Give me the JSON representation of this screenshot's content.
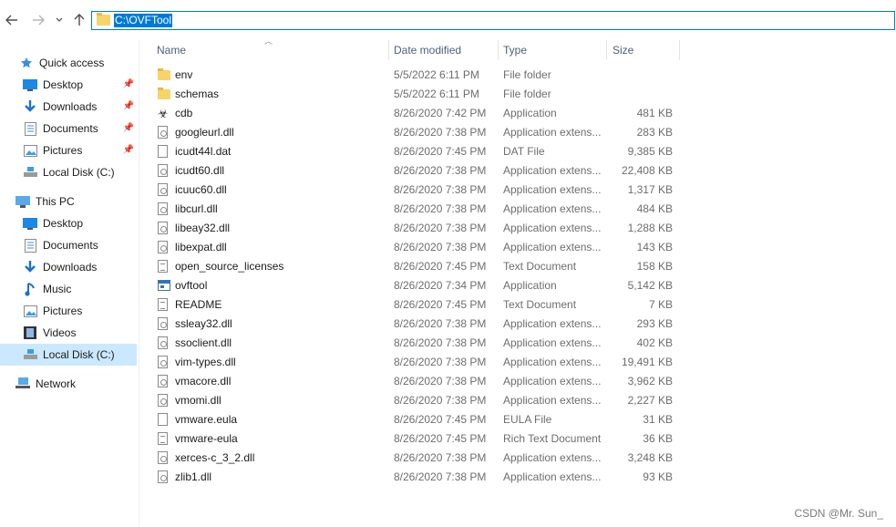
{
  "address": {
    "path": "C:\\OVFTool"
  },
  "sidebar": {
    "quick_access": "Quick access",
    "quick_items": [
      "Desktop",
      "Downloads",
      "Documents",
      "Pictures",
      "Local Disk (C:)"
    ],
    "this_pc": "This PC",
    "pc_items": [
      "Desktop",
      "Documents",
      "Downloads",
      "Music",
      "Pictures",
      "Videos",
      "Local Disk (C:)"
    ],
    "network": "Network"
  },
  "columns": {
    "name": "Name",
    "date": "Date modified",
    "type": "Type",
    "size": "Size"
  },
  "files": [
    {
      "name": "env",
      "date": "5/5/2022 6:11 PM",
      "type": "File folder",
      "size": "",
      "icon": "folder"
    },
    {
      "name": "schemas",
      "date": "5/5/2022 6:11 PM",
      "type": "File folder",
      "size": "",
      "icon": "folder"
    },
    {
      "name": "cdb",
      "date": "8/26/2020 7:42 PM",
      "type": "Application",
      "size": "481 KB",
      "icon": "cdb"
    },
    {
      "name": "googleurl.dll",
      "date": "8/26/2020 7:38 PM",
      "type": "Application extens...",
      "size": "283 KB",
      "icon": "dll"
    },
    {
      "name": "icudt44l.dat",
      "date": "8/26/2020 7:45 PM",
      "type": "DAT File",
      "size": "9,385 KB",
      "icon": "doc"
    },
    {
      "name": "icudt60.dll",
      "date": "8/26/2020 7:38 PM",
      "type": "Application extens...",
      "size": "22,408 KB",
      "icon": "dll"
    },
    {
      "name": "icuuc60.dll",
      "date": "8/26/2020 7:38 PM",
      "type": "Application extens...",
      "size": "1,317 KB",
      "icon": "dll"
    },
    {
      "name": "libcurl.dll",
      "date": "8/26/2020 7:38 PM",
      "type": "Application extens...",
      "size": "484 KB",
      "icon": "dll"
    },
    {
      "name": "libeay32.dll",
      "date": "8/26/2020 7:38 PM",
      "type": "Application extens...",
      "size": "1,288 KB",
      "icon": "dll"
    },
    {
      "name": "libexpat.dll",
      "date": "8/26/2020 7:38 PM",
      "type": "Application extens...",
      "size": "143 KB",
      "icon": "dll"
    },
    {
      "name": "open_source_licenses",
      "date": "8/26/2020 7:45 PM",
      "type": "Text Document",
      "size": "158 KB",
      "icon": "txt"
    },
    {
      "name": "ovftool",
      "date": "8/26/2020 7:34 PM",
      "type": "Application",
      "size": "5,142 KB",
      "icon": "app"
    },
    {
      "name": "README",
      "date": "8/26/2020 7:45 PM",
      "type": "Text Document",
      "size": "7 KB",
      "icon": "txt"
    },
    {
      "name": "ssleay32.dll",
      "date": "8/26/2020 7:38 PM",
      "type": "Application extens...",
      "size": "293 KB",
      "icon": "dll"
    },
    {
      "name": "ssoclient.dll",
      "date": "8/26/2020 7:38 PM",
      "type": "Application extens...",
      "size": "402 KB",
      "icon": "dll"
    },
    {
      "name": "vim-types.dll",
      "date": "8/26/2020 7:38 PM",
      "type": "Application extens...",
      "size": "19,491 KB",
      "icon": "dll"
    },
    {
      "name": "vmacore.dll",
      "date": "8/26/2020 7:38 PM",
      "type": "Application extens...",
      "size": "3,962 KB",
      "icon": "dll"
    },
    {
      "name": "vmomi.dll",
      "date": "8/26/2020 7:38 PM",
      "type": "Application extens...",
      "size": "2,227 KB",
      "icon": "dll"
    },
    {
      "name": "vmware.eula",
      "date": "8/26/2020 7:45 PM",
      "type": "EULA File",
      "size": "31 KB",
      "icon": "doc"
    },
    {
      "name": "vmware-eula",
      "date": "8/26/2020 7:45 PM",
      "type": "Rich Text Document",
      "size": "36 KB",
      "icon": "txt"
    },
    {
      "name": "xerces-c_3_2.dll",
      "date": "8/26/2020 7:38 PM",
      "type": "Application extens...",
      "size": "3,248 KB",
      "icon": "dll"
    },
    {
      "name": "zlib1.dll",
      "date": "8/26/2020 7:38 PM",
      "type": "Application extens...",
      "size": "93 KB",
      "icon": "dll"
    }
  ],
  "watermark": "CSDN @Mr. Sun_"
}
